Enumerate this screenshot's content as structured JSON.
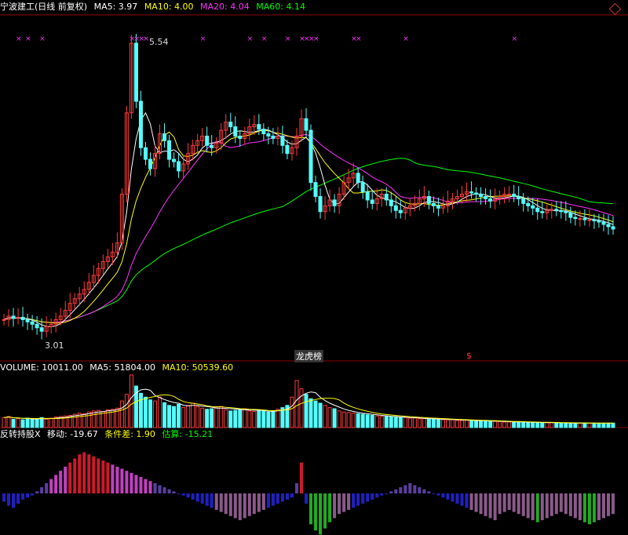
{
  "header": {
    "title": "宁波建工(日线 前复权)",
    "ma5": "MA5: 3.97",
    "ma10": "MA10: 4.00",
    "ma20": "MA20: 4.04",
    "ma60": "MA60: 4.14"
  },
  "volume_header": {
    "volume": "VOLUME: 10011.00",
    "ma5": "MA5: 51804.00",
    "ma10": "MA10: 50539.60"
  },
  "indicator_header": {
    "name": "反转持股X",
    "move": "移动: -19.67",
    "cond": "条件差: 1.90",
    "est": "估算: -15.21"
  },
  "annotations": {
    "high": "5.54",
    "low": "3.01",
    "lhb": "龙虎榜",
    "mark": "$"
  },
  "colors": {
    "up": "#ff3b3b",
    "down": "#54ffff",
    "ma5": "#ffffff",
    "ma10": "#ffff00",
    "ma20": "#ff33ff",
    "ma60": "#00ff00",
    "grid": "#8b0000",
    "marker": "#ff33ff"
  },
  "chart_data": {
    "type": "candlestick",
    "x_count": 130,
    "ylim": [
      2.9,
      5.75
    ],
    "close": [
      3.12,
      3.15,
      3.13,
      3.14,
      3.12,
      3.1,
      3.08,
      3.05,
      3.02,
      3.06,
      3.08,
      3.12,
      3.15,
      3.2,
      3.26,
      3.3,
      3.34,
      3.38,
      3.44,
      3.5,
      3.56,
      3.62,
      3.66,
      3.7,
      3.78,
      4.2,
      4.9,
      5.5,
      5.0,
      4.6,
      4.5,
      4.42,
      4.55,
      4.72,
      4.66,
      4.5,
      4.48,
      4.4,
      4.46,
      4.55,
      4.62,
      4.66,
      4.7,
      4.62,
      4.6,
      4.64,
      4.75,
      4.82,
      4.78,
      4.7,
      4.68,
      4.72,
      4.78,
      4.8,
      4.76,
      4.72,
      4.7,
      4.68,
      4.7,
      4.62,
      4.55,
      4.6,
      4.7,
      4.85,
      4.75,
      4.3,
      4.18,
      4.05,
      4.1,
      4.15,
      4.1,
      4.2,
      4.3,
      4.34,
      4.38,
      4.3,
      4.22,
      4.15,
      4.12,
      4.16,
      4.2,
      4.15,
      4.1,
      4.06,
      4.04,
      4.08,
      4.1,
      4.12,
      4.16,
      4.18,
      4.12,
      4.1,
      4.08,
      4.1,
      4.14,
      4.16,
      4.18,
      4.2,
      4.22,
      4.21,
      4.2,
      4.18,
      4.16,
      4.14,
      4.16,
      4.18,
      4.2,
      4.2,
      4.18,
      4.16,
      4.12,
      4.1,
      4.08,
      4.05,
      4.04,
      4.06,
      4.07,
      4.06,
      4.05,
      4.04,
      4.0,
      3.99,
      3.99,
      3.98,
      3.98,
      3.97,
      3.96,
      3.94,
      3.92,
      3.9
    ],
    "volume": [
      18,
      20,
      15,
      16,
      14,
      17,
      15,
      16,
      18,
      15,
      17,
      19,
      20,
      21,
      22,
      24,
      26,
      25,
      28,
      30,
      31,
      29,
      32,
      33,
      35,
      48,
      60,
      95,
      75,
      62,
      55,
      50,
      48,
      55,
      45,
      40,
      38,
      42,
      36,
      40,
      44,
      38,
      35,
      33,
      34,
      36,
      38,
      32,
      30,
      31,
      33,
      34,
      30,
      29,
      31,
      30,
      28,
      29,
      33,
      36,
      40,
      55,
      85,
      70,
      60,
      52,
      48,
      44,
      40,
      36,
      34,
      30,
      28,
      27,
      26,
      25,
      24,
      23,
      22,
      21,
      20,
      20,
      19,
      19,
      18,
      18,
      17,
      17,
      16,
      16,
      15,
      15,
      15,
      14,
      14,
      14,
      13,
      13,
      13,
      12,
      12,
      12,
      12,
      11,
      11,
      11,
      10,
      10,
      10,
      10,
      10,
      9,
      9,
      9,
      9,
      9,
      9,
      8,
      8,
      8,
      8,
      8,
      8,
      8,
      8,
      8,
      8,
      8,
      8,
      8
    ],
    "indicator": [
      -8,
      -12,
      -14,
      -10,
      -6,
      -4,
      -2,
      2,
      6,
      10,
      14,
      18,
      22,
      26,
      30,
      34,
      38,
      40,
      38,
      36,
      34,
      32,
      30,
      28,
      26,
      24,
      22,
      20,
      18,
      16,
      14,
      12,
      10,
      8,
      6,
      4,
      2,
      0,
      -2,
      -4,
      -6,
      -8,
      -10,
      -12,
      -14,
      -16,
      -18,
      -20,
      -22,
      -24,
      -26,
      -24,
      -22,
      -20,
      -18,
      -16,
      -14,
      -12,
      -10,
      -8,
      -6,
      -4,
      10,
      30,
      -10,
      -30,
      -36,
      -40,
      -34,
      -28,
      -24,
      -20,
      -18,
      -16,
      -14,
      -12,
      -10,
      -8,
      -6,
      -4,
      -2,
      0,
      2,
      4,
      6,
      8,
      10,
      8,
      6,
      4,
      2,
      0,
      -2,
      -4,
      -6,
      -8,
      -10,
      -12,
      -14,
      -16,
      -18,
      -20,
      -22,
      -24,
      -26,
      -20,
      -18,
      -16,
      -18,
      -20,
      -22,
      -24,
      -26,
      -28,
      -26,
      -24,
      -22,
      -20,
      -18,
      -20,
      -22,
      -24,
      -26,
      -28,
      -30,
      -28,
      -26,
      -24,
      -22,
      -20
    ]
  }
}
